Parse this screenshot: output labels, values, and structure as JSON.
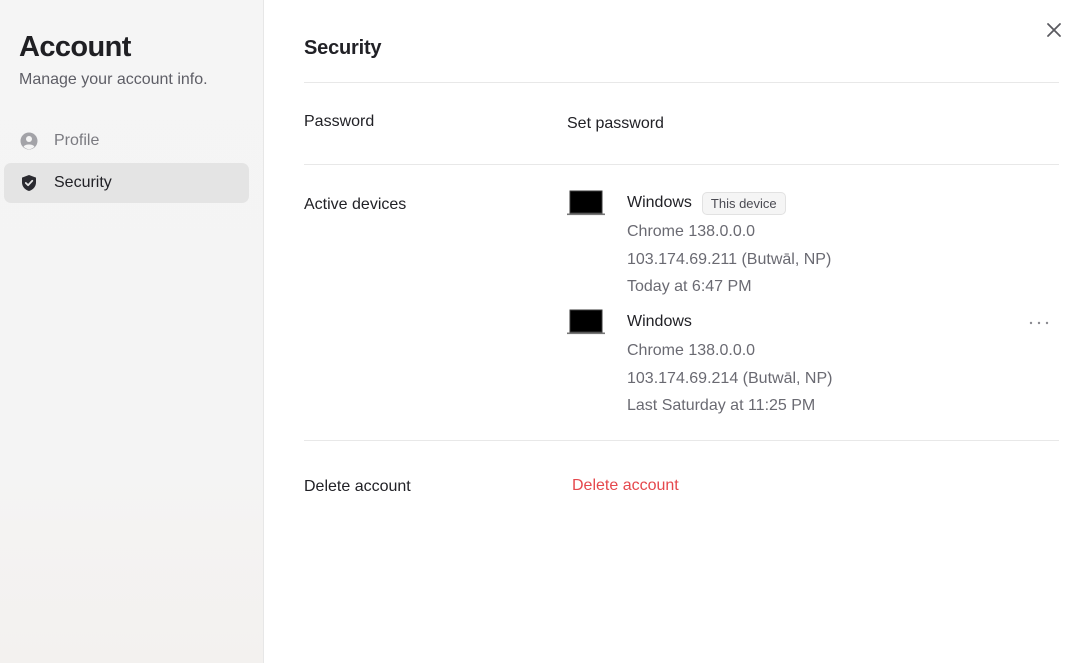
{
  "sidebar": {
    "title": "Account",
    "subtitle": "Manage your account info.",
    "items": [
      {
        "label": "Profile",
        "icon": "user-circle-icon",
        "active": false
      },
      {
        "label": "Security",
        "icon": "shield-check-icon",
        "active": true
      }
    ]
  },
  "main": {
    "title": "Security",
    "password": {
      "label": "Password",
      "action": "Set password"
    },
    "devices": {
      "label": "Active devices",
      "list": [
        {
          "name": "Windows",
          "badge": "This device",
          "browser": "Chrome 138.0.0.0",
          "location": "103.174.69.211 (Butwāl, NP)",
          "last_active": "Today at 6:47 PM"
        },
        {
          "name": "Windows",
          "browser": "Chrome 138.0.0.0",
          "location": "103.174.69.214 (Butwāl, NP)",
          "last_active": "Last Saturday at 11:25 PM"
        }
      ]
    },
    "delete": {
      "label": "Delete account",
      "action": "Delete account"
    }
  },
  "colors": {
    "danger": "#e5484d",
    "sidebar_bg": "#f5f5f5",
    "active_nav_bg": "#e4e4e4"
  }
}
